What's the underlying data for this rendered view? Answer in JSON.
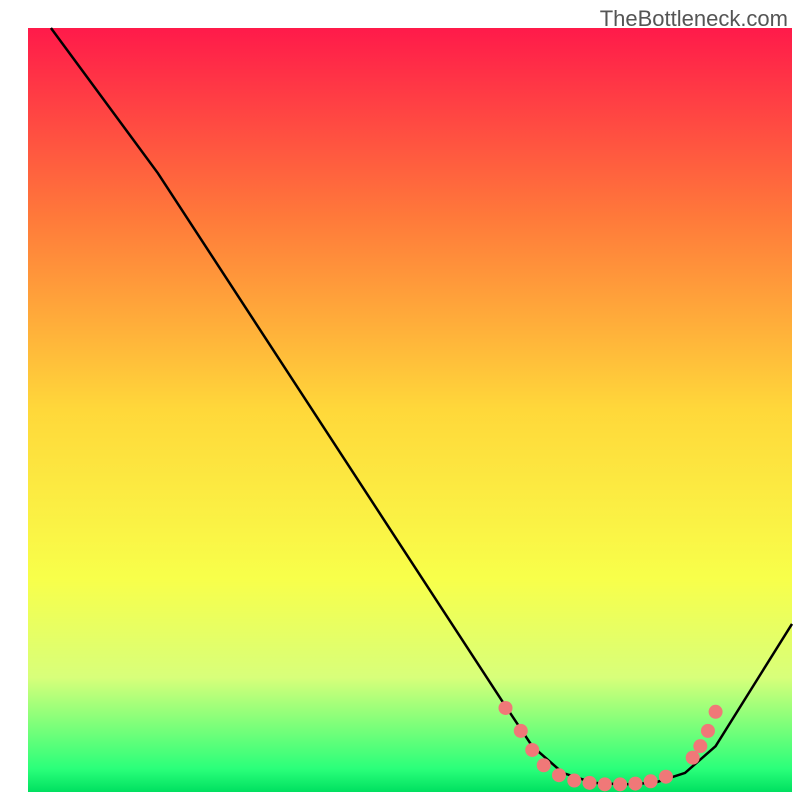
{
  "watermark": "TheBottleneck.com",
  "chart_data": {
    "type": "line",
    "title": "",
    "xlabel": "",
    "ylabel": "",
    "xlim": [
      0,
      100
    ],
    "ylim": [
      0,
      100
    ],
    "background_gradient": {
      "stops": [
        {
          "offset": 0,
          "color": "#ff1a4a"
        },
        {
          "offset": 0.25,
          "color": "#ff7a3a"
        },
        {
          "offset": 0.5,
          "color": "#ffd83a"
        },
        {
          "offset": 0.72,
          "color": "#f8ff4a"
        },
        {
          "offset": 0.85,
          "color": "#d8ff7a"
        },
        {
          "offset": 0.97,
          "color": "#2aff7a"
        },
        {
          "offset": 1.0,
          "color": "#00e060"
        }
      ]
    },
    "series": [
      {
        "name": "curve",
        "type": "line",
        "color": "#000000",
        "points": [
          {
            "x": 3,
            "y": 100
          },
          {
            "x": 17,
            "y": 81
          },
          {
            "x": 62,
            "y": 12
          },
          {
            "x": 66,
            "y": 6
          },
          {
            "x": 70,
            "y": 2.5
          },
          {
            "x": 74,
            "y": 1.2
          },
          {
            "x": 78,
            "y": 1.0
          },
          {
            "x": 82,
            "y": 1.2
          },
          {
            "x": 86,
            "y": 2.5
          },
          {
            "x": 90,
            "y": 6
          },
          {
            "x": 100,
            "y": 22
          }
        ]
      },
      {
        "name": "highlight-dots",
        "type": "scatter",
        "color": "#f07878",
        "points": [
          {
            "x": 62.5,
            "y": 11
          },
          {
            "x": 64.5,
            "y": 8
          },
          {
            "x": 66,
            "y": 5.5
          },
          {
            "x": 67.5,
            "y": 3.5
          },
          {
            "x": 69.5,
            "y": 2.2
          },
          {
            "x": 71.5,
            "y": 1.5
          },
          {
            "x": 73.5,
            "y": 1.2
          },
          {
            "x": 75.5,
            "y": 1.0
          },
          {
            "x": 77.5,
            "y": 1.0
          },
          {
            "x": 79.5,
            "y": 1.1
          },
          {
            "x": 81.5,
            "y": 1.4
          },
          {
            "x": 83.5,
            "y": 2.0
          },
          {
            "x": 87,
            "y": 4.5
          },
          {
            "x": 88,
            "y": 6
          },
          {
            "x": 89,
            "y": 8
          },
          {
            "x": 90,
            "y": 10.5
          }
        ]
      }
    ]
  }
}
